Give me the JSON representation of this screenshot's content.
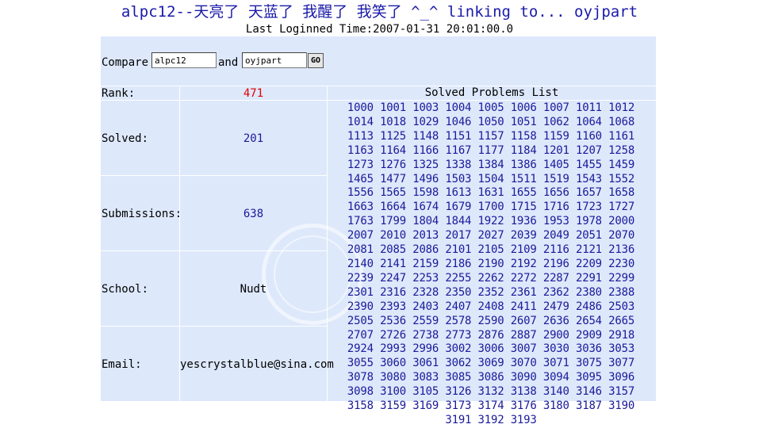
{
  "header": {
    "title": "alpc12--天亮了 天蓝了 我醒了 我笑了 ^_^ linking to... oyjpart",
    "last_login": "Last Loginned Time:2007-01-31 20:01:00.0"
  },
  "compare": {
    "label": "Compare",
    "user1": "alpc12",
    "and_label": "and",
    "user2": "oyjpart",
    "go_label": "GO"
  },
  "stats": {
    "rank_label": "Rank:",
    "rank_value": "471",
    "solved_label": "Solved:",
    "solved_value": "201",
    "submissions_label": "Submissions:",
    "submissions_value": "638",
    "school_label": "School:",
    "school_value": "Nudt",
    "email_label": "Email:",
    "email_value": "yescrystalblue@sina.com"
  },
  "problems": {
    "header": "Solved Problems List",
    "list": [
      "1000",
      "1001",
      "1003",
      "1004",
      "1005",
      "1006",
      "1007",
      "1011",
      "1012",
      "1014",
      "1018",
      "1029",
      "1046",
      "1050",
      "1051",
      "1062",
      "1064",
      "1068",
      "1113",
      "1125",
      "1148",
      "1151",
      "1157",
      "1158",
      "1159",
      "1160",
      "1161",
      "1163",
      "1164",
      "1166",
      "1167",
      "1177",
      "1184",
      "1201",
      "1207",
      "1258",
      "1273",
      "1276",
      "1325",
      "1338",
      "1384",
      "1386",
      "1405",
      "1455",
      "1459",
      "1465",
      "1477",
      "1496",
      "1503",
      "1504",
      "1511",
      "1519",
      "1543",
      "1552",
      "1556",
      "1565",
      "1598",
      "1613",
      "1631",
      "1655",
      "1656",
      "1657",
      "1658",
      "1663",
      "1664",
      "1674",
      "1679",
      "1700",
      "1715",
      "1716",
      "1723",
      "1727",
      "1763",
      "1799",
      "1804",
      "1844",
      "1922",
      "1936",
      "1953",
      "1978",
      "2000",
      "2007",
      "2010",
      "2013",
      "2017",
      "2027",
      "2039",
      "2049",
      "2051",
      "2070",
      "2081",
      "2085",
      "2086",
      "2101",
      "2105",
      "2109",
      "2116",
      "2121",
      "2136",
      "2140",
      "2141",
      "2159",
      "2186",
      "2190",
      "2192",
      "2196",
      "2209",
      "2230",
      "2239",
      "2247",
      "2253",
      "2255",
      "2262",
      "2272",
      "2287",
      "2291",
      "2299",
      "2301",
      "2316",
      "2328",
      "2350",
      "2352",
      "2361",
      "2362",
      "2380",
      "2388",
      "2390",
      "2393",
      "2403",
      "2407",
      "2408",
      "2411",
      "2479",
      "2486",
      "2503",
      "2505",
      "2536",
      "2559",
      "2578",
      "2590",
      "2607",
      "2636",
      "2654",
      "2665",
      "2707",
      "2726",
      "2738",
      "2773",
      "2876",
      "2887",
      "2900",
      "2909",
      "2918",
      "2924",
      "2993",
      "2996",
      "3002",
      "3006",
      "3007",
      "3030",
      "3036",
      "3053",
      "3055",
      "3060",
      "3061",
      "3062",
      "3069",
      "3070",
      "3071",
      "3075",
      "3077",
      "3078",
      "3080",
      "3083",
      "3085",
      "3086",
      "3090",
      "3094",
      "3095",
      "3096",
      "3098",
      "3100",
      "3105",
      "3126",
      "3132",
      "3138",
      "3140",
      "3146",
      "3157",
      "3158",
      "3159",
      "3169",
      "3173",
      "3174",
      "3176",
      "3180",
      "3187",
      "3190",
      "3191",
      "3192",
      "3193"
    ]
  },
  "colors": {
    "panel_bg": "#dde8fb",
    "title_blue": "#1a1aaa",
    "link_blue": "#1a1a99",
    "rank_red": "#e00000"
  }
}
